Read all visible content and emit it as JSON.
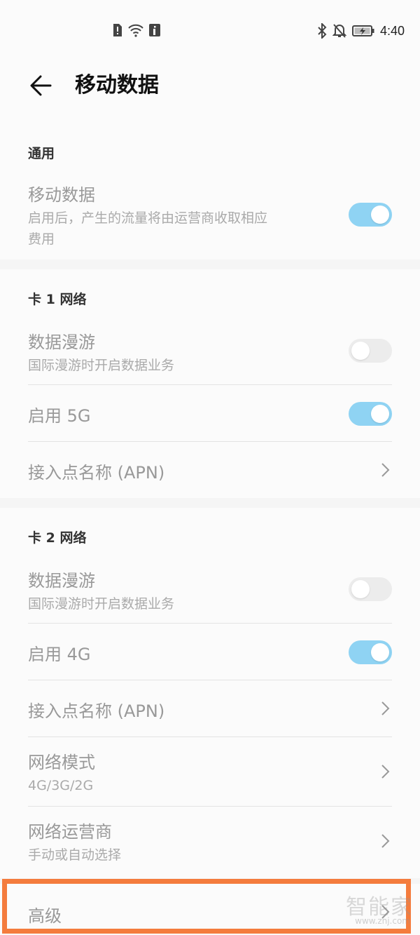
{
  "status_bar": {
    "time": "4:40",
    "left_icons": [
      "sim-alert-icon",
      "wifi-icon",
      "info-icon"
    ],
    "right_icons": [
      "bluetooth-icon",
      "mute-icon",
      "battery-charging-icon"
    ]
  },
  "header": {
    "title": "移动数据",
    "back_icon": "back-arrow-icon"
  },
  "general": {
    "section_title": "通用",
    "mobile_data": {
      "title": "移动数据",
      "subtitle_line1": "启用后，产生的流量将由运营商收取相应",
      "subtitle_line2": "费用",
      "enabled": true
    }
  },
  "card1": {
    "section_title": "卡 1 网络",
    "roaming": {
      "title": "数据漫游",
      "subtitle": "国际漫游时开启数据业务",
      "enabled": false
    },
    "enable_network": {
      "title": "启用 5G",
      "enabled": true
    },
    "apn": {
      "title": "接入点名称 (APN)"
    }
  },
  "card2": {
    "section_title": "卡 2 网络",
    "roaming": {
      "title": "数据漫游",
      "subtitle": "国际漫游时开启数据业务",
      "enabled": false
    },
    "enable_network": {
      "title": "启用 4G",
      "enabled": true
    },
    "apn": {
      "title": "接入点名称 (APN)"
    },
    "network_mode": {
      "title": "网络模式",
      "subtitle": "4G/3G/2G"
    },
    "operator": {
      "title": "网络运营商",
      "subtitle": "手动或自动选择"
    }
  },
  "advanced": {
    "title": "高级"
  },
  "watermark": {
    "text": "智能家",
    "sub": "www.znj.com"
  },
  "colors": {
    "toggle_on": "#8fd3f3",
    "toggle_off": "#ececec",
    "highlight": "#f47c3d"
  }
}
